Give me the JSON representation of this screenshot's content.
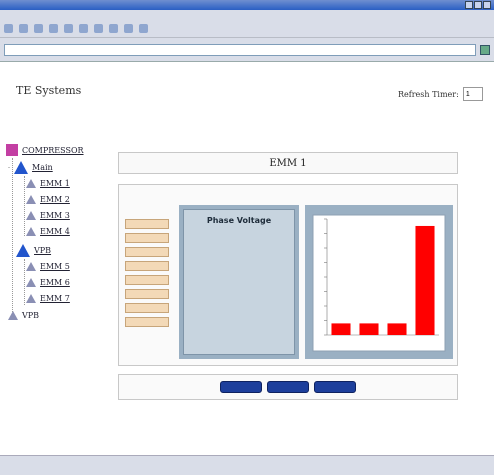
{
  "browser": {
    "title": "",
    "address": "",
    "status_left": "",
    "status_right": ""
  },
  "header": {
    "company": "TE Systems",
    "refresh_label": "Refresh Timer:",
    "refresh_value": "1"
  },
  "tree": {
    "root": "COMPRESSOR",
    "group1": "Main",
    "g1_items": [
      "EMM 1",
      "EMM 2",
      "EMM 3",
      "EMM 4"
    ],
    "group2": "VPB",
    "g2_items": [
      "EMM 5",
      "EMM 6",
      "EMM 7"
    ],
    "last": "VPB"
  },
  "panel": {
    "title": "EMM 1",
    "buttons": [
      "",
      "",
      "",
      "",
      "",
      "",
      "",
      ""
    ],
    "voltage_title": "Phase Voltage",
    "voltage_lines": [
      "",
      "",
      "",
      ""
    ],
    "bottom_buttons": [
      "",
      "",
      ""
    ]
  },
  "chart_data": {
    "type": "bar",
    "categories": [
      "",
      "",
      "",
      ""
    ],
    "values": [
      10,
      10,
      10,
      94
    ],
    "ylim": [
      0,
      100
    ],
    "title": "",
    "xlabel": "",
    "ylabel": "",
    "bar_color": "#ff0000",
    "grid": false
  },
  "colors": {
    "tree_root": "#c33fa3",
    "tree_group": "#2255cc",
    "button_bg": "#f3d9b7",
    "action_button_bg": "#1d3f9c",
    "panel_bg": "#9ab0c3"
  }
}
